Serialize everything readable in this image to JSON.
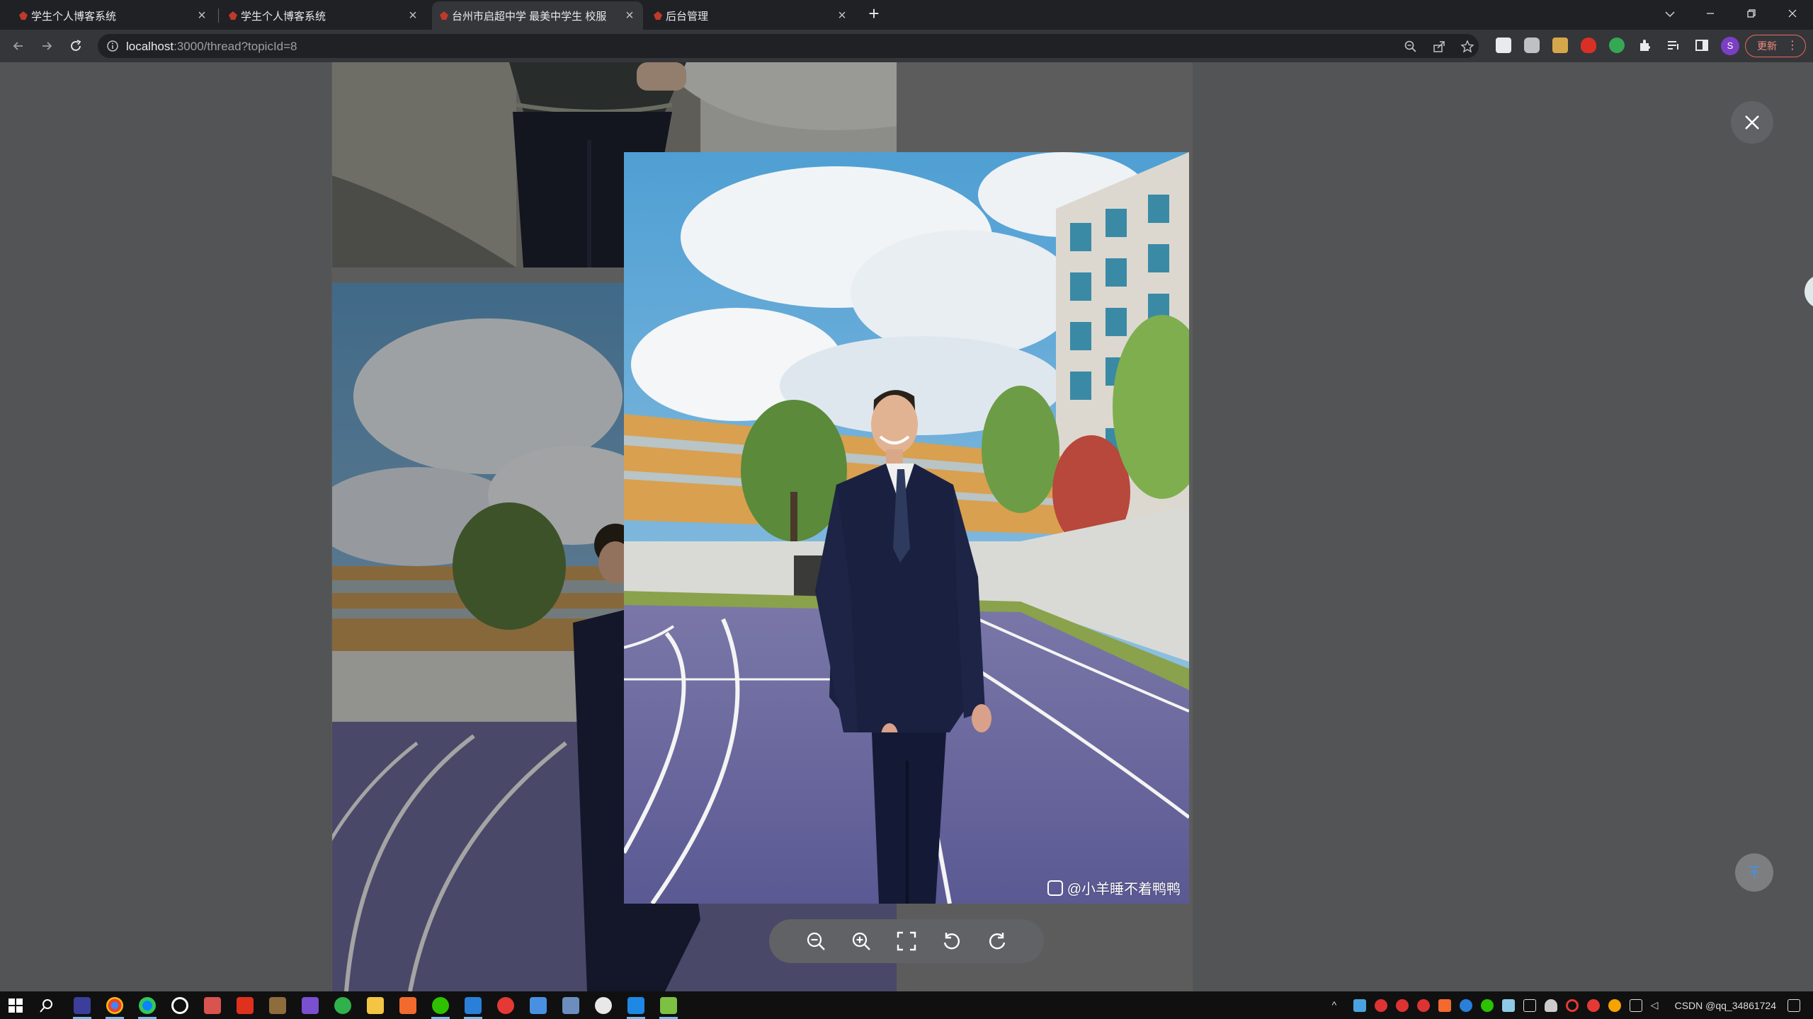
{
  "browser": {
    "tabs": [
      {
        "title": "学生个人博客系统",
        "active": false
      },
      {
        "title": "学生个人博客系统",
        "active": false
      },
      {
        "title": "台州市启超中学 最美中学生 校服",
        "active": true
      },
      {
        "title": "后台管理",
        "active": false
      }
    ],
    "new_tab_label": "+",
    "address": {
      "host": "localhost",
      "rest": ":3000/thread?topicId=8"
    },
    "profile_initial": "S",
    "update_label": "更新"
  },
  "viewer": {
    "watermark": "@小羊睡不着鸭鸭",
    "actions": [
      "zoom-out",
      "zoom-in",
      "fit-screen",
      "rotate-left",
      "rotate-right"
    ]
  },
  "taskbar": {
    "tray_text": "CSDN @qq_34861724"
  },
  "colors": {
    "accent_red": "#c0392b",
    "overlay_button": "#606266",
    "backtop_icon": "#4a90d6"
  }
}
